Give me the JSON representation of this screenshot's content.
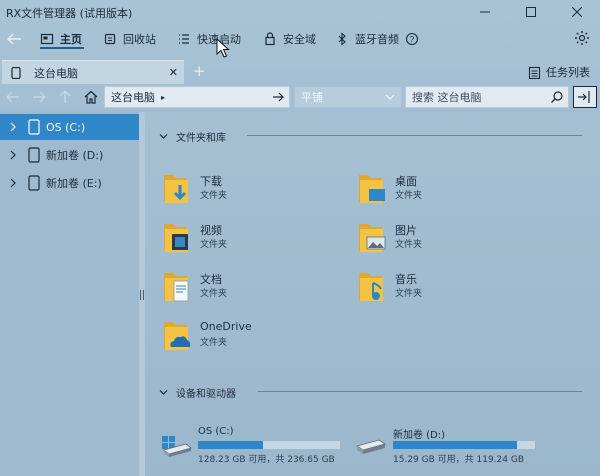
{
  "window": {
    "title": "RX文件管理器 (试用版本)"
  },
  "menu": {
    "items": [
      {
        "label": "主页",
        "icon": "home-outline-icon",
        "active": true
      },
      {
        "label": "回收站",
        "icon": "recycle-bin-icon"
      },
      {
        "label": "快速启动",
        "icon": "quick-launch-list-icon"
      },
      {
        "label": "安全域",
        "icon": "lock-icon"
      },
      {
        "label": "蓝牙音频",
        "icon": "bluetooth-icon"
      }
    ],
    "help_icon": "help-circle-icon",
    "settings_icon": "gear-icon"
  },
  "tabs": {
    "items": [
      {
        "label": "这台电脑",
        "icon": "pc-icon"
      }
    ],
    "task_list_label": "任务列表"
  },
  "address": {
    "path": "这台电脑",
    "view_mode": "平铺",
    "search_placeholder": "搜索 这台电脑"
  },
  "sidebar": {
    "items": [
      {
        "label": "OS (C:)",
        "selected": true
      },
      {
        "label": "新加卷 (D:)"
      },
      {
        "label": "新加卷 (E:)"
      }
    ]
  },
  "main": {
    "folders_group": {
      "title": "文件夹和库",
      "items": [
        {
          "name": "下载",
          "type": "文件夹",
          "icon": "downloads-folder-icon"
        },
        {
          "name": "桌面",
          "type": "文件夹",
          "icon": "desktop-folder-icon"
        },
        {
          "name": "视频",
          "type": "文件夹",
          "icon": "videos-folder-icon"
        },
        {
          "name": "图片",
          "type": "文件夹",
          "icon": "pictures-folder-icon"
        },
        {
          "name": "文档",
          "type": "文件夹",
          "icon": "documents-folder-icon"
        },
        {
          "name": "音乐",
          "type": "文件夹",
          "icon": "music-folder-icon"
        },
        {
          "name": "OneDrive",
          "type": "文件夹",
          "icon": "onedrive-folder-icon"
        }
      ]
    },
    "drives_group": {
      "title": "设备和驱动器",
      "items": [
        {
          "name": "OS (C:)",
          "info": "128.23 GB 可用，共 236.65 GB",
          "used_fraction": 0.458
        },
        {
          "name": "新加卷 (D:)",
          "info": "15.29 GB 可用，共 119.24 GB",
          "used_fraction": 0.872
        }
      ]
    }
  },
  "colors": {
    "accent": "#2f86c9",
    "folder_yellow": "#f3c443"
  }
}
